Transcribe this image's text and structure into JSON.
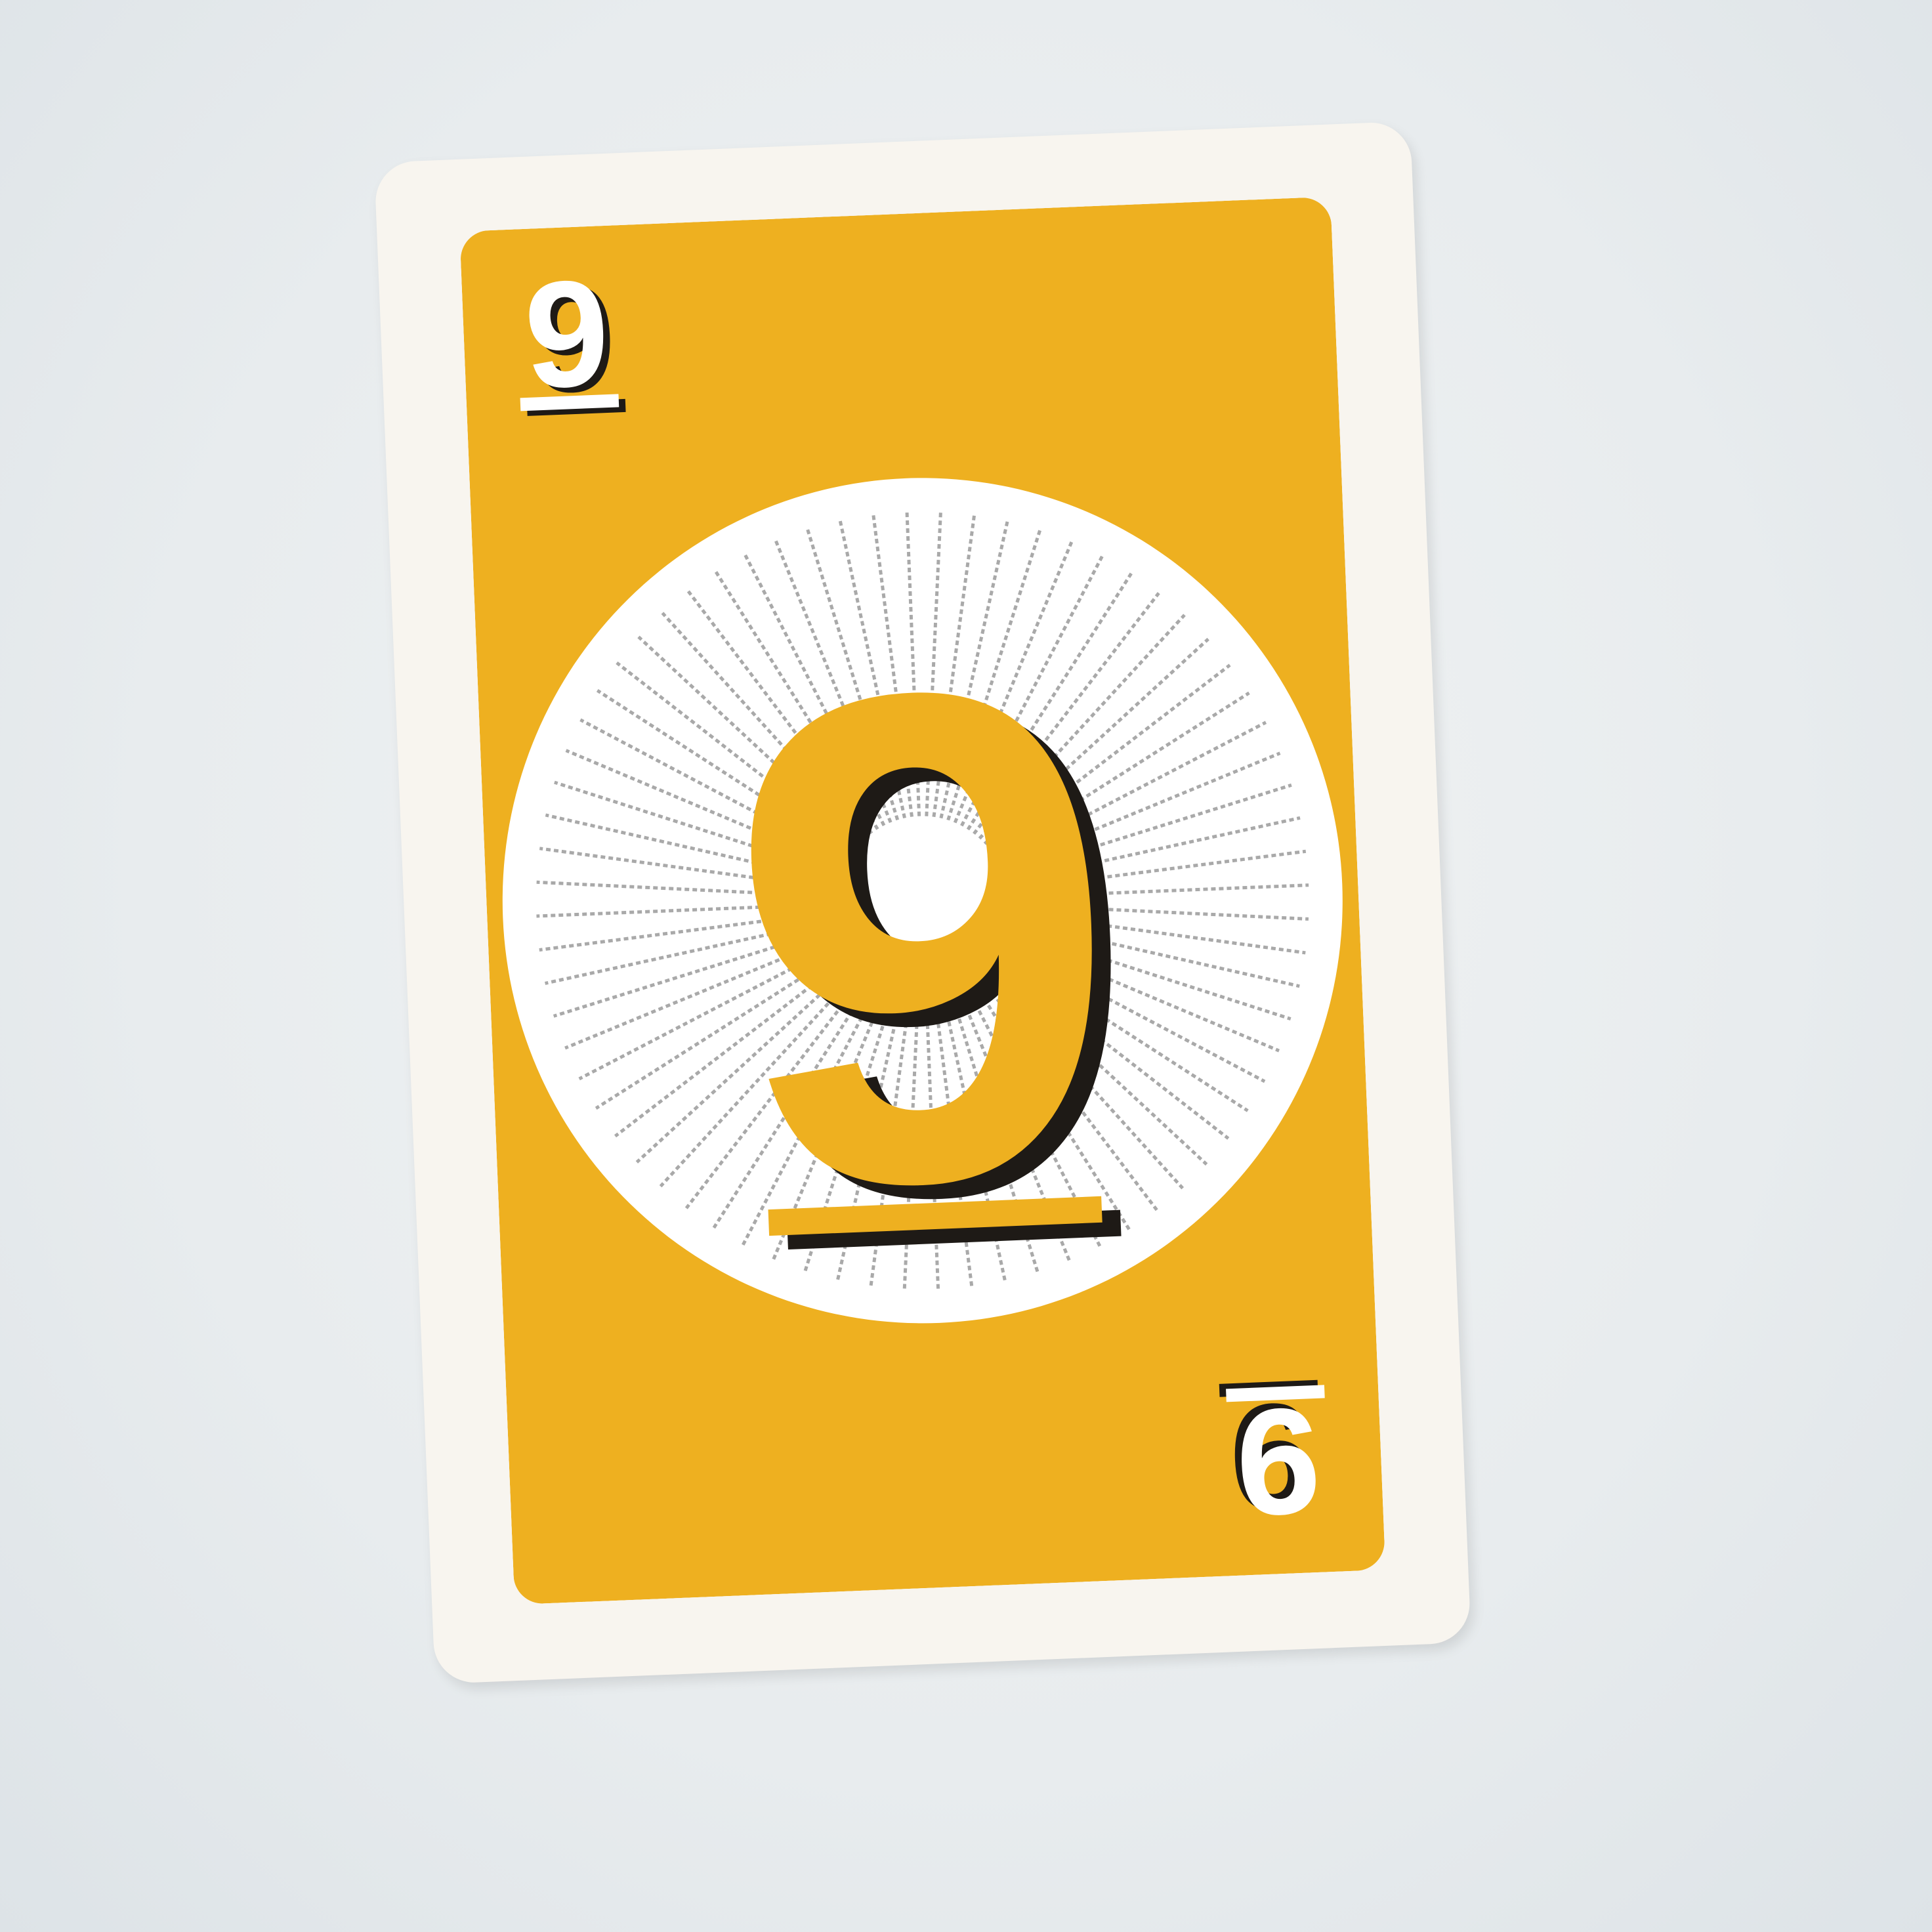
{
  "card": {
    "color_name": "yellow",
    "face_color": "#eeb020",
    "border_color": "#f8f5ef",
    "oval_color": "#ffffff",
    "ray_color": "#a9a9a9",
    "shadow_color": "#1e1a16",
    "value": "9",
    "corner_value": "9"
  }
}
